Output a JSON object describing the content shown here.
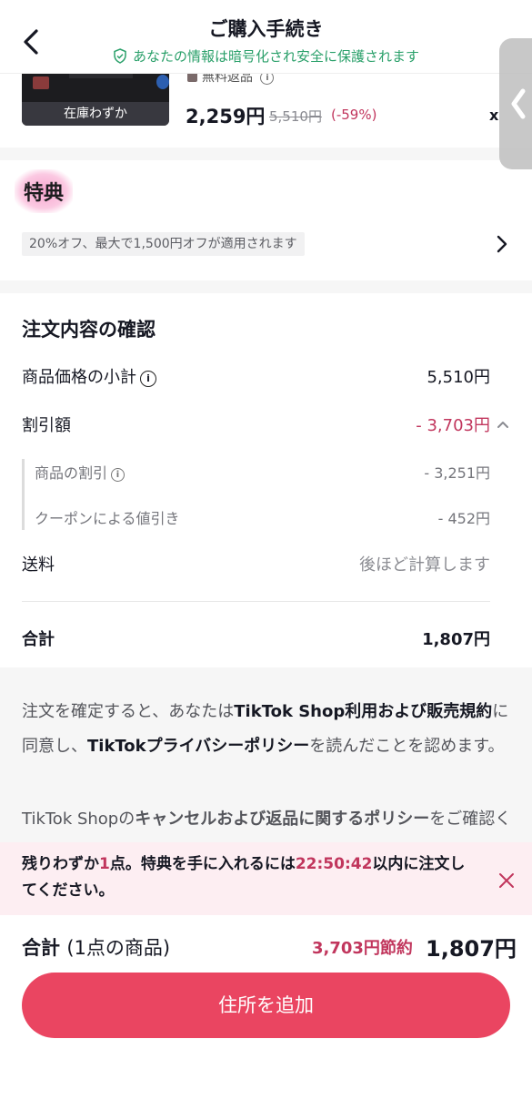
{
  "header": {
    "title": "ご購入手続き",
    "secure_note": "あなたの情報は暗号化され安全に保護されます",
    "colors": {
      "secure": "#2aa06a"
    }
  },
  "product": {
    "stock_label": "在庫わずか",
    "return_label": "無料返品",
    "price": "2,259円",
    "original_price": "5,510円",
    "discount_pct": "(-59%)",
    "quantity_mark": "x"
  },
  "benefits": {
    "title": "特典",
    "tag": "20%オフ、最大で1,500円オフが適用されます"
  },
  "summary": {
    "title": "注文内容の確認",
    "subtotal_label": "商品価格の小計",
    "subtotal_value": "5,510円",
    "discount_label": "割引額",
    "discount_value": "- 3,703円",
    "item_discount_label": "商品の割引",
    "item_discount_value": "- 3,251円",
    "coupon_label": "クーポンによる値引き",
    "coupon_value": "- 452円",
    "shipping_label": "送料",
    "shipping_value": "後ほど計算します",
    "total_label": "合計",
    "total_value": "1,807円"
  },
  "terms": {
    "p1_a": "注文を確定すると、あなたは",
    "p1_b": "TikTok Shop利用および販売規約",
    "p1_c": "に同意し、",
    "p1_d": "TikTokプライバシーポリシー",
    "p1_e": "を読んだことを認めます。",
    "p2_a": "TikTok Shopの",
    "p2_b": "キャンセルおよび返品に関するポリシー",
    "p2_c": "をご確認ください。"
  },
  "urgency": {
    "a": "残りわずか",
    "count": "1",
    "b": "点。特典を手に入れるには",
    "timer": "22:50:42",
    "c": "以内に注文してください。"
  },
  "footer": {
    "total_label": "合計",
    "item_count": "(1点の商品)",
    "savings": "3,703円節約",
    "amount": "1,807円",
    "cta": "住所を追加"
  },
  "colors": {
    "accent": "#ea4561",
    "discount_red": "#c1365d"
  }
}
